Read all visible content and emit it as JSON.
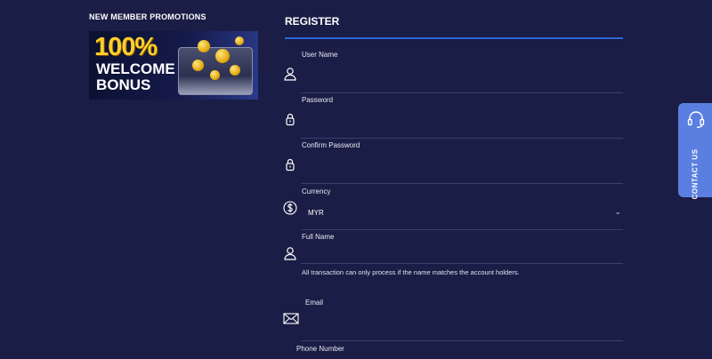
{
  "promotions": {
    "title": "NEW MEMBER PROMOTIONS",
    "banner": {
      "percent": "100%",
      "line1": "WELCOME",
      "line2": "BONUS"
    }
  },
  "register": {
    "title": "REGISTER",
    "fields": {
      "username": {
        "label": "User Name",
        "icon": "user-icon"
      },
      "password": {
        "label": "Password",
        "icon": "lock-icon"
      },
      "confirm_password": {
        "label": "Confirm Password",
        "icon": "lock-icon"
      },
      "currency": {
        "label": "Currency",
        "icon": "dollar-icon",
        "value": "MYR"
      },
      "full_name": {
        "label": "Full Name",
        "icon": "user-icon"
      },
      "email": {
        "label": "Email",
        "icon": "envelope-icon"
      },
      "phone": {
        "label": "Phone Number"
      }
    },
    "full_name_note": "All transaction can only process if the name matches the account holders."
  },
  "contact": {
    "label": "CONTACT US",
    "icon": "headset-icon"
  },
  "colors": {
    "background": "#1a1d45",
    "accent": "#2f64d9",
    "contact_tab": "#5b7fe0",
    "banner_yellow": "#ffd02a"
  }
}
